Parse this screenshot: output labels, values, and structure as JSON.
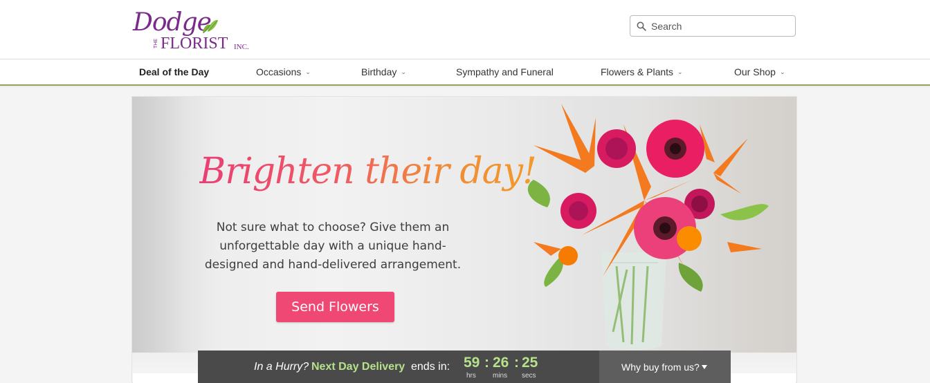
{
  "logo": {
    "dodge": "Dodge",
    "the": "THE",
    "florist": "FLORIST",
    "inc": "INC."
  },
  "search": {
    "placeholder": "Search"
  },
  "nav": {
    "items": [
      {
        "label": "Deal of the Day",
        "has_chevron": false
      },
      {
        "label": "Occasions",
        "has_chevron": true
      },
      {
        "label": "Birthday",
        "has_chevron": true
      },
      {
        "label": "Sympathy and Funeral",
        "has_chevron": false
      },
      {
        "label": "Flowers & Plants",
        "has_chevron": true
      },
      {
        "label": "Our Shop",
        "has_chevron": true
      }
    ]
  },
  "hero": {
    "headline": "Brighten their day!",
    "subtext": "Not sure what to choose? Give them an unforgettable day with a unique hand-designed and hand-delivered arrangement.",
    "cta": "Send Flowers"
  },
  "countdown": {
    "prefix": "In a Hurry?",
    "highlight": "Next Day Delivery",
    "suffix": "ends in:",
    "hours": "59",
    "minutes": "26",
    "seconds": "25",
    "hours_unit": "hrs",
    "minutes_unit": "mins",
    "seconds_unit": "secs",
    "why_label": "Why buy from us?"
  },
  "colors": {
    "brand_purple": "#7a2a8a",
    "cta_pink": "#f04874",
    "countdown_bg": "#4a4a4a",
    "countdown_green": "#b5e28a",
    "nav_underline": "#9aa15e"
  }
}
